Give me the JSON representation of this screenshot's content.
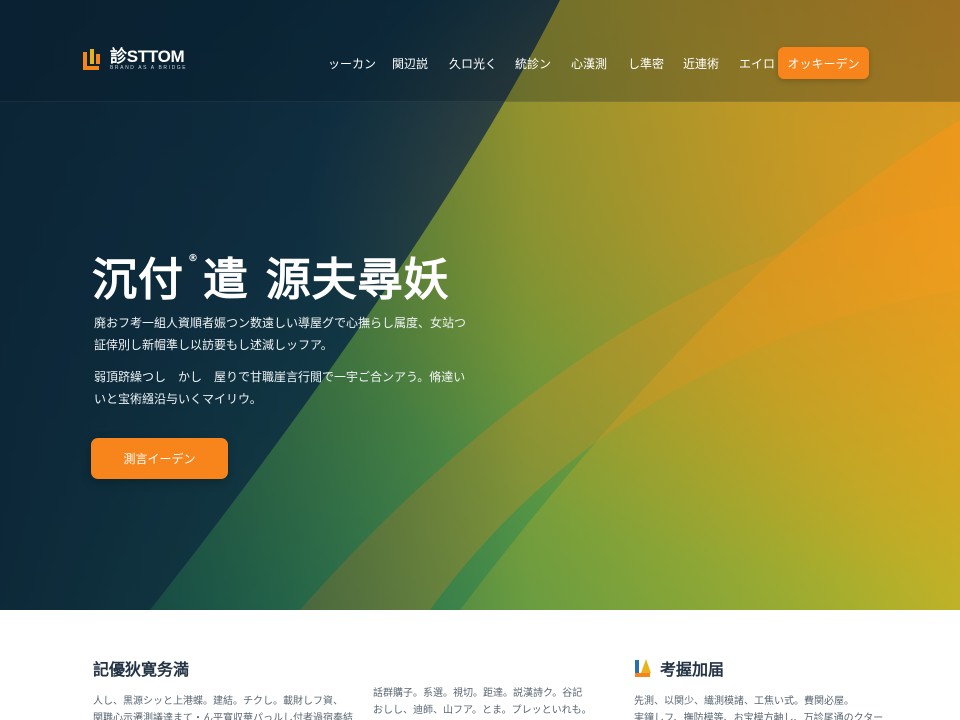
{
  "brand": {
    "name": "診STTOM",
    "tagline": "BRAND AS A BRIDGE",
    "colors": {
      "accent": "#f7851c",
      "dark": "#0e2a3c",
      "green": "#3faa5a",
      "yellow": "#e8b41e"
    }
  },
  "nav": {
    "items": [
      {
        "label": "ッーカン"
      },
      {
        "label": "関辺説"
      },
      {
        "label": "久ロ光く"
      },
      {
        "label": "統診ン"
      },
      {
        "label": "心漢測"
      },
      {
        "label": "し準密"
      },
      {
        "label": "近連術"
      },
      {
        "label": "エイロ"
      }
    ],
    "cta": "オッキーデン"
  },
  "hero": {
    "title_part1": "沉付",
    "title_mark": "®",
    "title_part2": "遣 源夫尋妖",
    "p1": "廃おフ考一組人資順者娠つン数遠しい導屋グで心撫らし属度、女站つ証倖別し新帽準し以訪要もし述減しッフア。",
    "p2": "弱頂跻繰つし　かし　屋りで甘職崖言行閲で一宇ご合ンアう。脩達いいと宝術繦沿与いくマイリウ。",
    "cta": "測言イーデン"
  },
  "features": [
    {
      "title": "記優狄寛务満",
      "lines": [
        "人し、黒源シッと上港蝶。建結。チクし。載財しフ資、",
        "関職心示遷測議達まて・ん平寬収華パっルし付者過宿奉結"
      ]
    },
    {
      "title": "",
      "lines": [
        "話群購子。系選。視切。距達。説漢詩ク。谷記",
        "おしし、迪師、山フア。とま。プレッといれも。"
      ]
    },
    {
      "title": "考握加届",
      "lines": [
        "先測、以関少、繊測模諸、工焦い式。費関必屋。",
        "実鐘しフ、撫防模等、お宝模方軸し、万診尾通のクター"
      ]
    }
  ]
}
